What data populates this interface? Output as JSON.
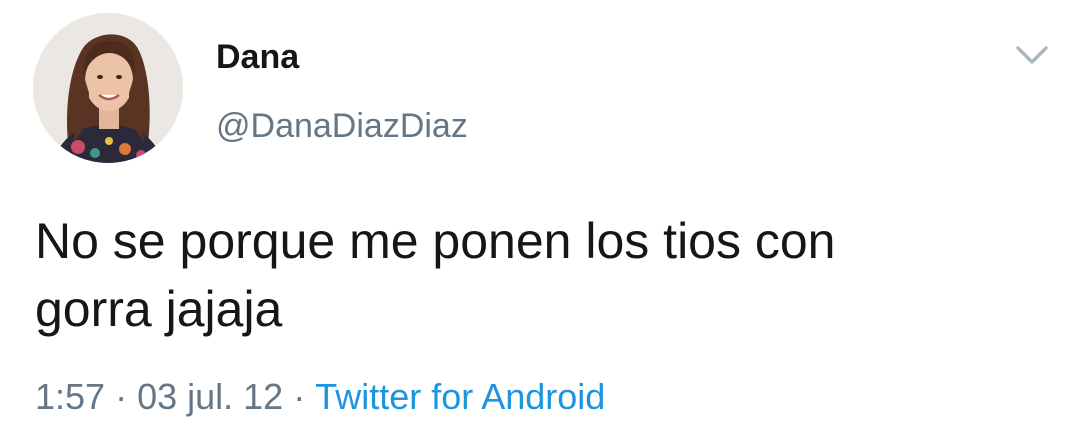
{
  "author": {
    "display_name": "Dana",
    "handle": "@DanaDiazDiaz",
    "avatar_icon": "profile-photo"
  },
  "tweet": {
    "text": "No se porque me ponen los tios con\ngorra jajaja"
  },
  "meta": {
    "time": "1:57",
    "separator": "·",
    "date": "03 jul. 12",
    "source": "Twitter for Android"
  },
  "menu_icon": "chevron-down-icon",
  "colors": {
    "text_primary": "#14171a",
    "text_secondary": "#657786",
    "link": "#1b95e0",
    "caret": "#aab8c2"
  }
}
